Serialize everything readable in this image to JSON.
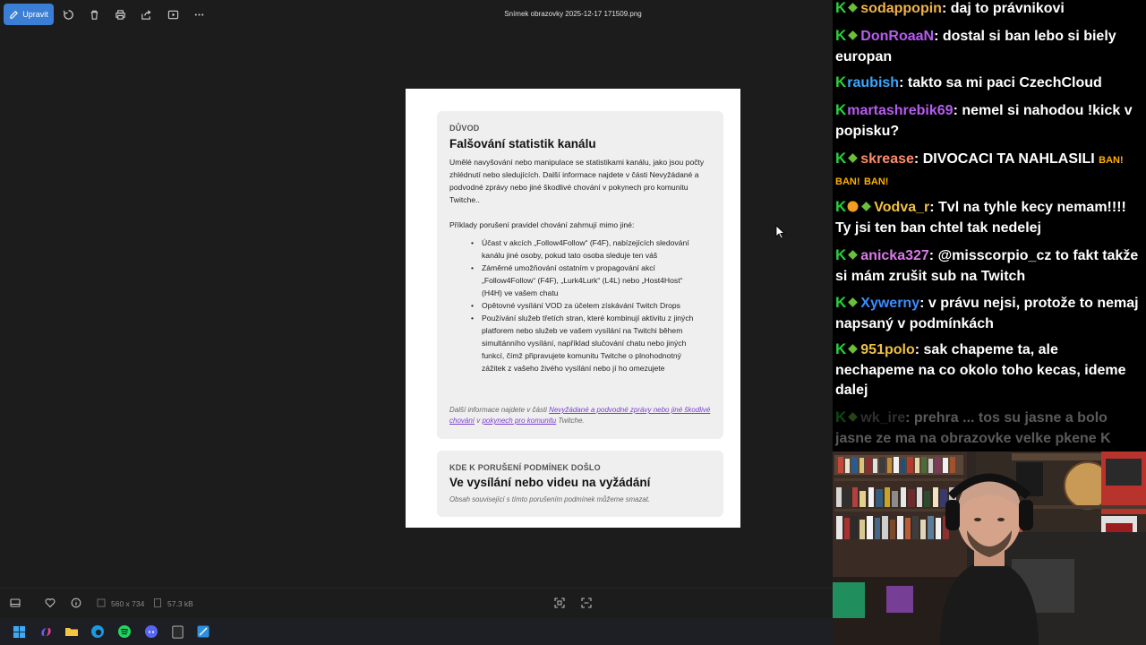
{
  "viewer": {
    "toolbar": {
      "edit_label": "Upravit"
    },
    "file_title": "Snímek obrazovky 2025-12-17 171509.png",
    "status": {
      "dimensions": "560 x 734",
      "file_size": "57.3 kB"
    }
  },
  "document": {
    "card1": {
      "label": "DŮVOD",
      "title": "Falšování statistik kanálu",
      "description": "Umělé navyšování nebo manipulace se statistikami kanálu, jako jsou počty zhlédnutí nebo sledujících. Další informace najdete v části Nevyžádané a podvodné zprávy nebo jiné škodlivé chování v pokynech pro komunitu Twitche..",
      "examples_intro": "Příklady porušení pravidel chování zahrnují mimo jiné:",
      "examples": [
        "Účast v akcích „Follow4Follow“ (F4F), nabízejících sledování kanálu jiné osoby, pokud tato osoba sleduje ten váš",
        "Záměrné umožňování ostatním v propagování akcí „Follow4Follow“ (F4F), „Lurk4Lurk“ (L4L) nebo „Host4Host“ (H4H) ve vašem chatu",
        "Opětovné vysílání VOD za účelem získávání Twitch Drops",
        "Používání služeb třetích stran, které kombinují aktivitu z jiných platforem nebo služeb ve vašem vysílání na Twitchi během simultánního vysílání, například slučování chatu nebo jiných funkcí, čímž připravujete komunitu Twitche o plnohodnotný zážitek z vašeho živého vysílání nebo jí ho omezujete"
      ],
      "footnote_prefix": "Další informace najdete v části ",
      "footnote_link1": "Nevyžádané a podvodné zprávy nebo jiné škodlivé chování",
      "footnote_mid": " v ",
      "footnote_link2": "pokynech pro komunitu",
      "footnote_suffix": " Twitche."
    },
    "card2": {
      "label": "KDE K PORUŠENÍ PODMÍNEK DOŠLO",
      "title": "Ve vysílání nebo videu na vyžádání",
      "note": "Obsah související s tímto porušením podmínek můžeme smazat."
    }
  },
  "chat": {
    "messages": [
      {
        "user": "sodappopin",
        "color": "#f0b34a",
        "text": "daj to právnikovi"
      },
      {
        "user": "DonRoaaN",
        "color": "#b65cf0",
        "text": "dostal si ban lebo si biely europan"
      },
      {
        "user": "raubish",
        "color": "#3aa7ff",
        "text": "takto sa mi paci CzechCloud"
      },
      {
        "user": "martashrebik69",
        "color": "#b65cf0",
        "text": "nemel si nahodou !kick v popisku?"
      },
      {
        "user": "skrease",
        "color": "#ff8c6b",
        "text": "DIVOCACI TA NAHLASILI"
      },
      {
        "user": "Vodva_r",
        "color": "#f0c040",
        "text": "Tvl na tyhle kecy nemam!!!! Ty jsi ten ban chtel tak nedelej"
      },
      {
        "user": "anicka327",
        "color": "#d97ae8",
        "text": "@misscorpio_cz to fakt takže si mám zrušit sub na Twitch"
      },
      {
        "user": "Xywerny",
        "color": "#3a8dff",
        "text": "v právu nejsi, protože to nemaj napsaný v podmínkách"
      },
      {
        "user": "951polo",
        "color": "#f0c040",
        "text": "sak chapeme ta, ale nechapeme na co okolo toho kecas, ideme dalej"
      },
      {
        "user": "wk_ire",
        "color": "#888888",
        "text": "prehra ... tos su jasne a bolo jasne ze ma na obrazovke velke pkene K"
      }
    ],
    "emote_text": "BAN!"
  }
}
